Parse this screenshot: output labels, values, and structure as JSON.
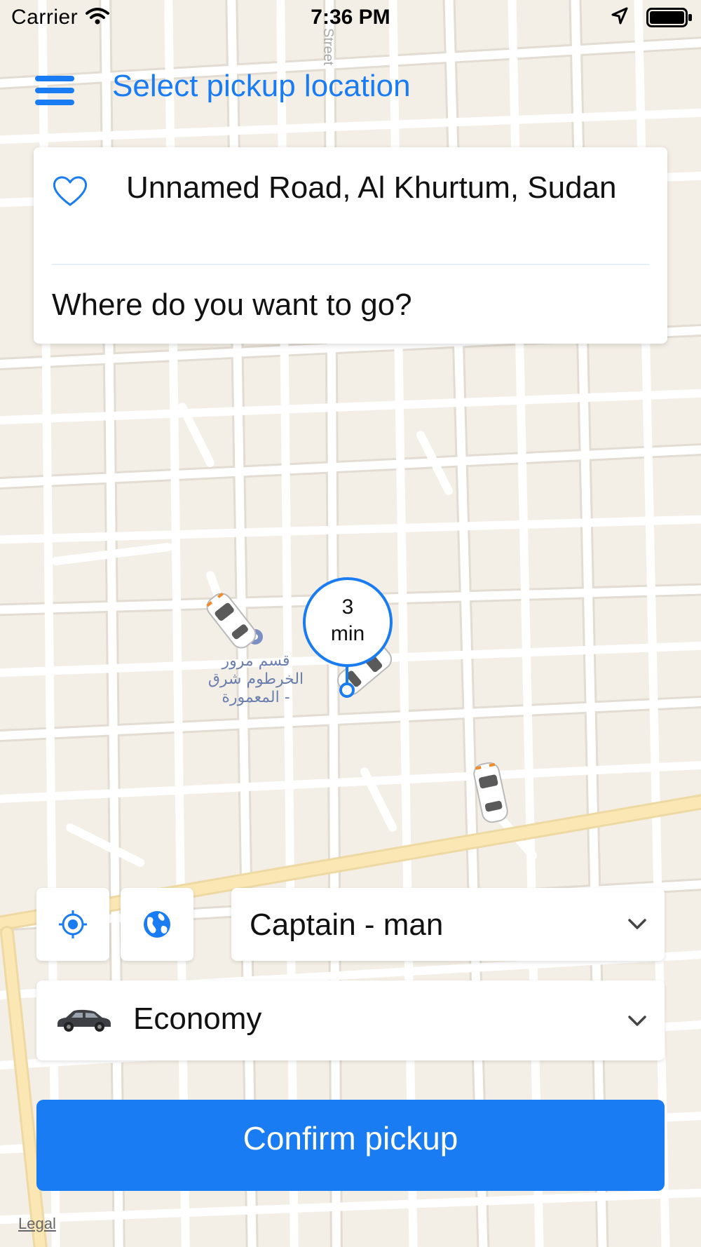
{
  "status_bar": {
    "carrier": "Carrier",
    "time": "7:36 PM"
  },
  "header": {
    "title": "Select pickup location",
    "menu_icon": "hamburger-menu-icon"
  },
  "address_card": {
    "favorite_icon": "heart-icon",
    "pickup_address": "Unnamed Road, Al Khurtum, Sudan",
    "destination_placeholder": "Where do you want to go?"
  },
  "map": {
    "eta_number": "3",
    "eta_unit": "min",
    "poi_label_line1": "قسم مرور",
    "poi_label_line2": "الخرطوم شرق",
    "poi_label_line3": "- المعمورة",
    "street_label": "Street"
  },
  "controls": {
    "locate_icon": "crosshair-icon",
    "globe_icon": "globe-icon",
    "captain_value": "Captain - man",
    "car_type_value": "Economy",
    "car_icon": "car-icon",
    "chevron_icon": "chevron-down-icon"
  },
  "confirm_label": "Confirm pickup",
  "legal_label": "Legal",
  "colors": {
    "accent": "#1a7cf2",
    "map_background": "#f4efe6",
    "map_roads": "#ffffff",
    "main_road": "#fbe7b4"
  }
}
